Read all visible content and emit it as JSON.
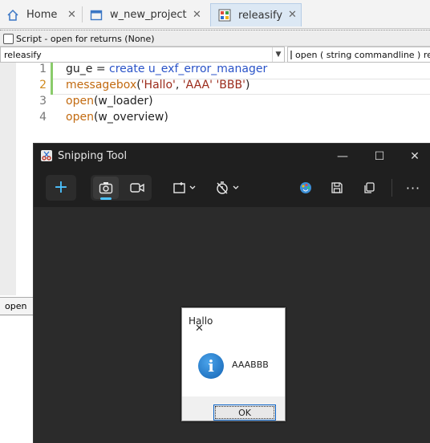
{
  "tabs": [
    {
      "label": "Home",
      "icon": "home-icon",
      "active": false
    },
    {
      "label": "w_new_project",
      "icon": "window-icon",
      "active": false
    },
    {
      "label": "releasify",
      "icon": "app-grid-icon",
      "active": true
    }
  ],
  "script_header": "Script - open for  returns (None)",
  "object_combo": "releasify",
  "event_combo": "open ( string commandline ) returns",
  "code_lines": [
    {
      "num": "1",
      "parts": [
        [
          "gu_e = ",
          "plain"
        ],
        [
          "create",
          "blue"
        ],
        [
          " ",
          "plain"
        ],
        [
          "u_exf_error_manager",
          "blue"
        ]
      ]
    },
    {
      "num": "2",
      "parts": [
        [
          "messagebox",
          "orange"
        ],
        [
          "(",
          "plain"
        ],
        [
          "'Hallo'",
          "str"
        ],
        [
          ", ",
          "plain"
        ],
        [
          "'AAA'",
          "str"
        ],
        [
          " ",
          "plain"
        ],
        [
          "'BBB'",
          "str"
        ],
        [
          ")",
          "plain"
        ]
      ]
    },
    {
      "num": "3",
      "parts": [
        [
          "open",
          "orange"
        ],
        [
          "(w_loader)",
          "plain"
        ]
      ]
    },
    {
      "num": "4",
      "parts": [
        [
          "open",
          "orange"
        ],
        [
          "(w_overview)",
          "plain"
        ]
      ]
    }
  ],
  "bottom_tab": "open",
  "snipping_tool": {
    "title": "Snipping Tool",
    "new_label": "+",
    "controls": {
      "minimize": "—",
      "maximize": "☐",
      "close": "✕"
    }
  },
  "message_box": {
    "title": "Hallo",
    "message": "AAABBB",
    "ok_label": "OK",
    "close": "✕"
  },
  "colors": {
    "accent": "#4cc2ff",
    "keyword_blue": "#2a53c8",
    "function_orange": "#c26a10",
    "string_red": "#9b2a1a",
    "change_marker": "#8acb6b"
  }
}
